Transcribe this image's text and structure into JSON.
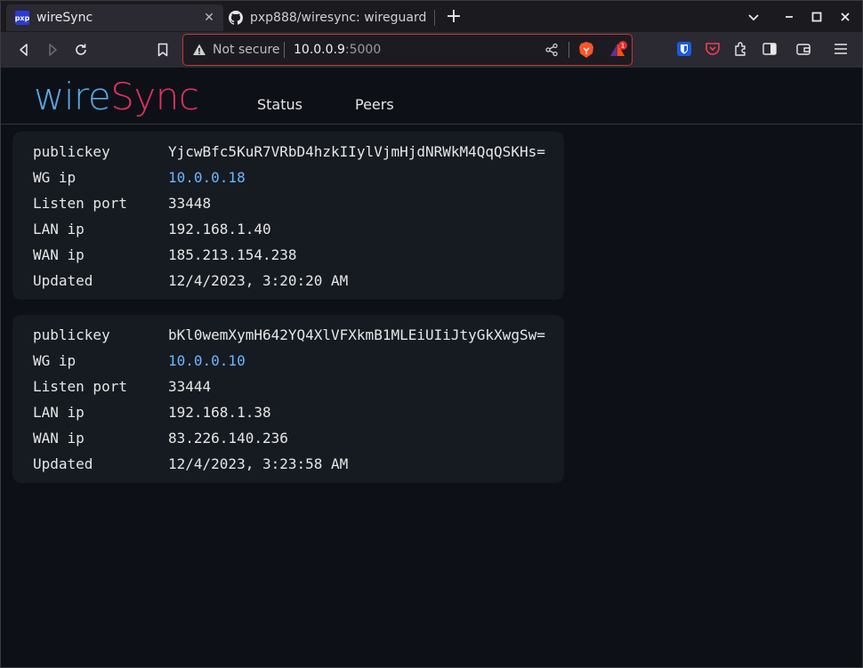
{
  "browser": {
    "tabs": [
      {
        "title": "wireSync",
        "favicon": "pxp-icon"
      },
      {
        "title": "pxp888/wiresync: wireguard",
        "favicon": "github-icon"
      }
    ],
    "url": {
      "security_label": "Not secure",
      "host": "10.0.0.9",
      "port": ":5000"
    },
    "bat_badge": "1"
  },
  "app": {
    "logo_part1": "wire",
    "logo_part2": "Sync",
    "nav": [
      "Status",
      "Peers"
    ],
    "colors": {
      "logo_wire": "#5aa9e6",
      "logo_sync": "#e0315e",
      "link": "#6cb6ff"
    }
  },
  "peers": [
    {
      "rows": [
        {
          "label": "publickey",
          "value": "YjcwBfc5KuR7VRbD4hzkIIylVjmHjdNRWkM4QqQSKHs="
        },
        {
          "label": "WG ip",
          "value": "10.0.0.18"
        },
        {
          "label": "Listen port",
          "value": "33448"
        },
        {
          "label": "LAN ip",
          "value": "192.168.1.40"
        },
        {
          "label": "WAN ip",
          "value": "185.213.154.238"
        },
        {
          "label": "Updated",
          "value": "12/4/2023, 3:20:20 AM"
        }
      ]
    },
    {
      "rows": [
        {
          "label": "publickey",
          "value": "bKl0wemXymH642YQ4XlVFXkmB1MLEiUIiJtyGkXwgSw="
        },
        {
          "label": "WG ip",
          "value": "10.0.0.10"
        },
        {
          "label": "Listen port",
          "value": "33444"
        },
        {
          "label": "LAN ip",
          "value": "192.168.1.38"
        },
        {
          "label": "WAN ip",
          "value": "83.226.140.236"
        },
        {
          "label": "Updated",
          "value": "12/4/2023, 3:23:58 AM"
        }
      ]
    }
  ]
}
